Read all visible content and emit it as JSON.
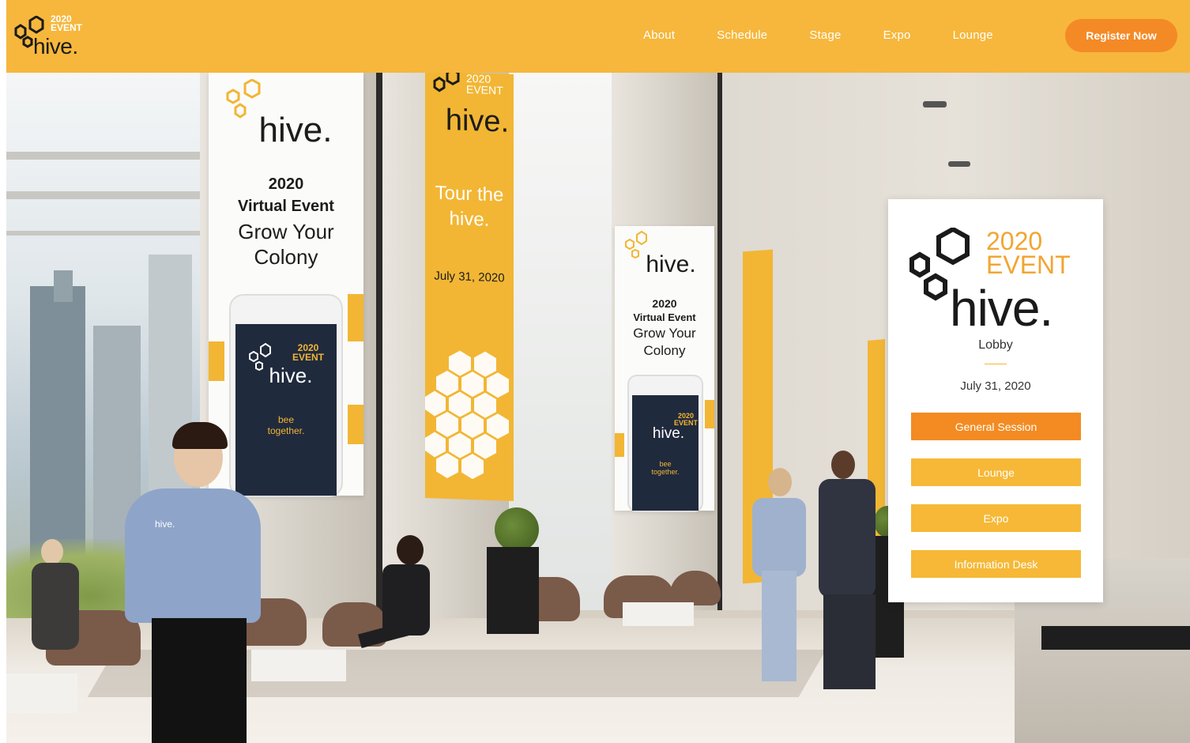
{
  "header": {
    "logo": {
      "year": "2020",
      "word": "EVENT",
      "name": "hive."
    },
    "nav": [
      "About",
      "Schedule",
      "Stage",
      "Expo",
      "Lounge"
    ],
    "register_label": "Register Now"
  },
  "banners": {
    "left": {
      "brand": "hive.",
      "year": "2020",
      "subtitle": "Virtual Event",
      "tag1": "Grow Your",
      "tag2": "Colony",
      "phone": {
        "year": "2020",
        "word": "EVENT",
        "name": "hive.",
        "tagline1": "bee",
        "tagline2": "together."
      }
    },
    "center_yellow": {
      "year": "2020",
      "word": "EVENT",
      "name": "hive.",
      "tour1": "Tour the",
      "tour2": "hive.",
      "date": "July 31, 2020"
    },
    "center_white": {
      "brand": "hive.",
      "year": "2020",
      "subtitle": "Virtual Event",
      "tag1": "Grow Your",
      "tag2": "Colony",
      "phone": {
        "year": "2020",
        "word": "EVENT",
        "name": "hive.",
        "tagline1": "bee",
        "tagline2": "together."
      }
    }
  },
  "staff_shirt_logo": "hive.",
  "card": {
    "year": "2020",
    "word": "EVENT",
    "name": "hive.",
    "subtitle": "Lobby",
    "date": "July 31, 2020",
    "buttons": [
      "General Session",
      "Lounge",
      "Expo",
      "Information Desk"
    ]
  },
  "colors": {
    "header": "#f6b73c",
    "register": "#f48a26",
    "accent": "#f2b634",
    "active_button": "#f38b22"
  }
}
